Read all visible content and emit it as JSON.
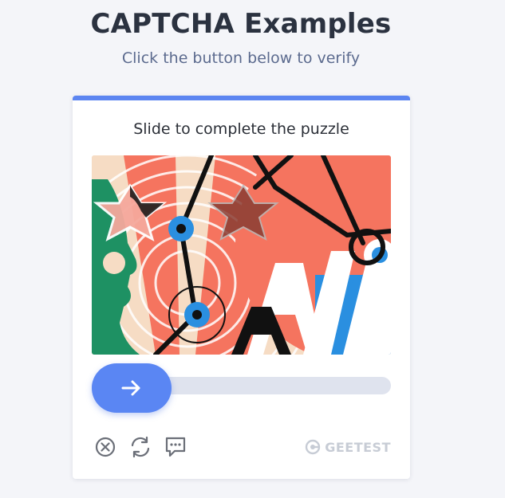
{
  "header": {
    "title": "CAPTCHA Examples",
    "subtitle": "Click the button below to verify"
  },
  "captcha": {
    "instruction": "Slide to complete the puzzle",
    "slider": {
      "handle_icon": "arrow-right-icon",
      "progress": 0
    },
    "tools": [
      {
        "name": "close",
        "icon": "close-circle-icon"
      },
      {
        "name": "refresh",
        "icon": "refresh-icon"
      },
      {
        "name": "feedback",
        "icon": "feedback-chat-icon"
      }
    ],
    "brand": {
      "text": "GEETEST",
      "icon": "geetest-logo-icon"
    }
  },
  "colors": {
    "accent": "#5c85f1",
    "knob": "#5a86f3",
    "track": "#dfe3ee",
    "title": "#2b3240",
    "subtitle": "#5b6a8e",
    "brand_gray": "#c7ccd5",
    "background": "#f4f5f9"
  }
}
